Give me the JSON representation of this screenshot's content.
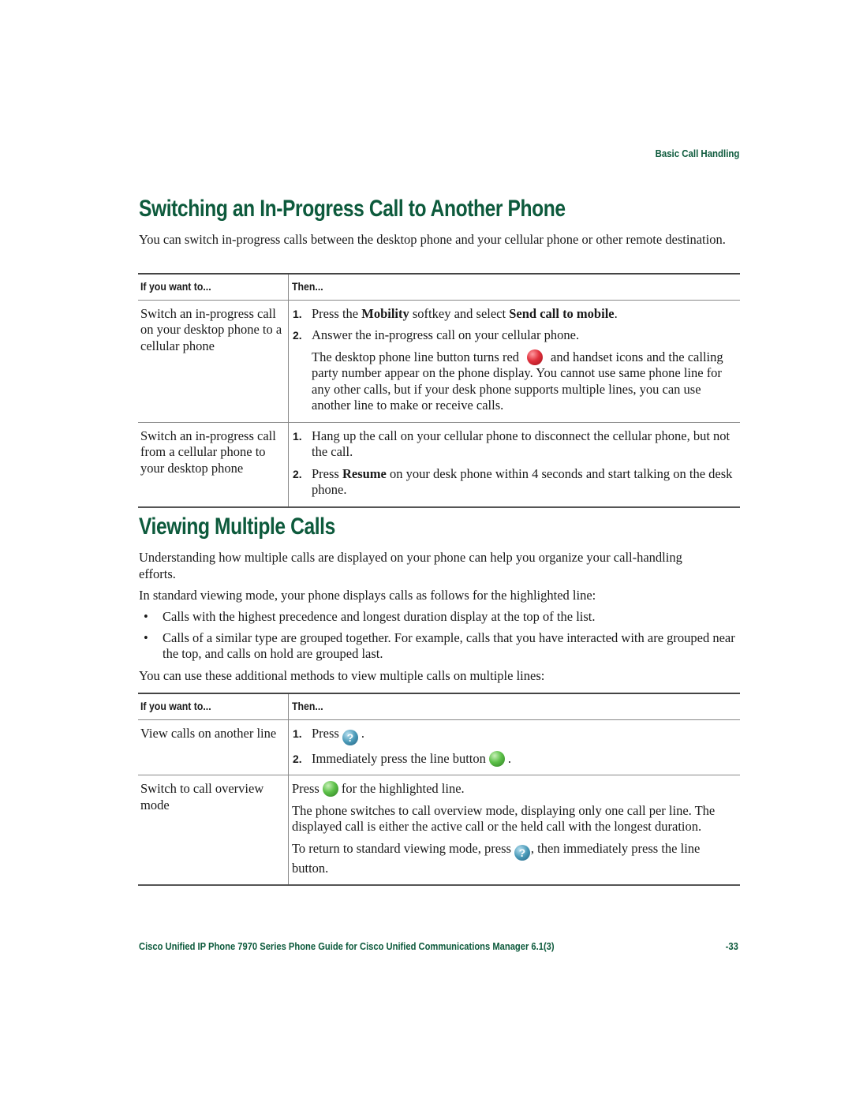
{
  "running_head": "Basic Call Handling",
  "section1": {
    "title": "Switching an In-Progress Call to Another Phone",
    "intro": "You can switch in-progress calls between the desktop phone and your cellular phone or other remote destination.",
    "table": {
      "headers": [
        "If you want to...",
        "Then..."
      ],
      "rows": [
        {
          "want": "Switch an in-progress call on your desktop phone to a cellular phone",
          "steps": [
            {
              "num": "1.",
              "pre": "Press the ",
              "kw1": "Mobility",
              "mid": " softkey and select ",
              "kw2": "Send call to mobile",
              "post": "."
            },
            {
              "num": "2.",
              "text": "Answer the in-progress call on your cellular phone.",
              "note_pre": "The desktop phone line button turns red",
              "note_icon": "red-line-button-icon",
              "note_post": "and handset icons and the calling party number appear on the phone display. You cannot use same phone line for any other calls, but if your desk phone supports multiple lines, you can use another line to make or receive calls."
            }
          ]
        },
        {
          "want": "Switch an in-progress call from a cellular phone to your desktop phone",
          "steps": [
            {
              "num": "1.",
              "text": "Hang up the call on your cellular phone to disconnect the cellular phone, but not the call."
            },
            {
              "num": "2.",
              "pre": "Press ",
              "kw1": "Resume",
              "post": " on your desk phone within 4 seconds and start talking on the desk phone."
            }
          ]
        }
      ]
    }
  },
  "section2": {
    "title": "Viewing Multiple Calls",
    "para1": "Understanding how multiple calls are displayed on your phone can help you organize your call-handling efforts.",
    "para2": "In standard viewing mode, your phone displays calls as follows for the highlighted line:",
    "bullets": [
      "Calls with the highest precedence and longest duration display at the top of the list.",
      "Calls of a similar type are grouped together. For example, calls that you have interacted with are grouped near the top, and calls on hold are grouped last."
    ],
    "bullet_glyph": "•",
    "para3": "You can use these additional methods to view multiple calls on multiple lines:",
    "table": {
      "headers": [
        "If you want to...",
        "Then..."
      ],
      "rows": [
        {
          "want": "View calls on another line",
          "steps": [
            {
              "num": "1.",
              "pre": "Press",
              "icon": "help-button-icon",
              "icon_glyph": "?",
              "post": "."
            },
            {
              "num": "2.",
              "pre": "Immediately press the line button",
              "icon": "green-line-button-icon",
              "post": "."
            }
          ]
        },
        {
          "want": "Switch to call overview mode",
          "p1_pre": "Press",
          "p1_icon": "green-line-button-icon",
          "p1_post": "for the highlighted line.",
          "p2": "The phone switches to call overview mode, displaying only one call per line. The displayed call is either the active call or the held call with the longest duration.",
          "p3_pre": "To return to standard viewing mode, press",
          "p3_icon": "help-button-icon",
          "p3_icon_glyph": "?",
          "p3_post": ", then immediately press the line button."
        }
      ]
    }
  },
  "footer": {
    "title": "Cisco Unified IP Phone 7970 Series Phone Guide for Cisco Unified Communications Manager 6.1(3)",
    "page": "-33"
  },
  "colors": {
    "heading_green": "#0d5a3c",
    "line_button_red": "#e0303c",
    "line_button_green": "#5cc048",
    "help_button_blue": "#4a9ab8"
  }
}
